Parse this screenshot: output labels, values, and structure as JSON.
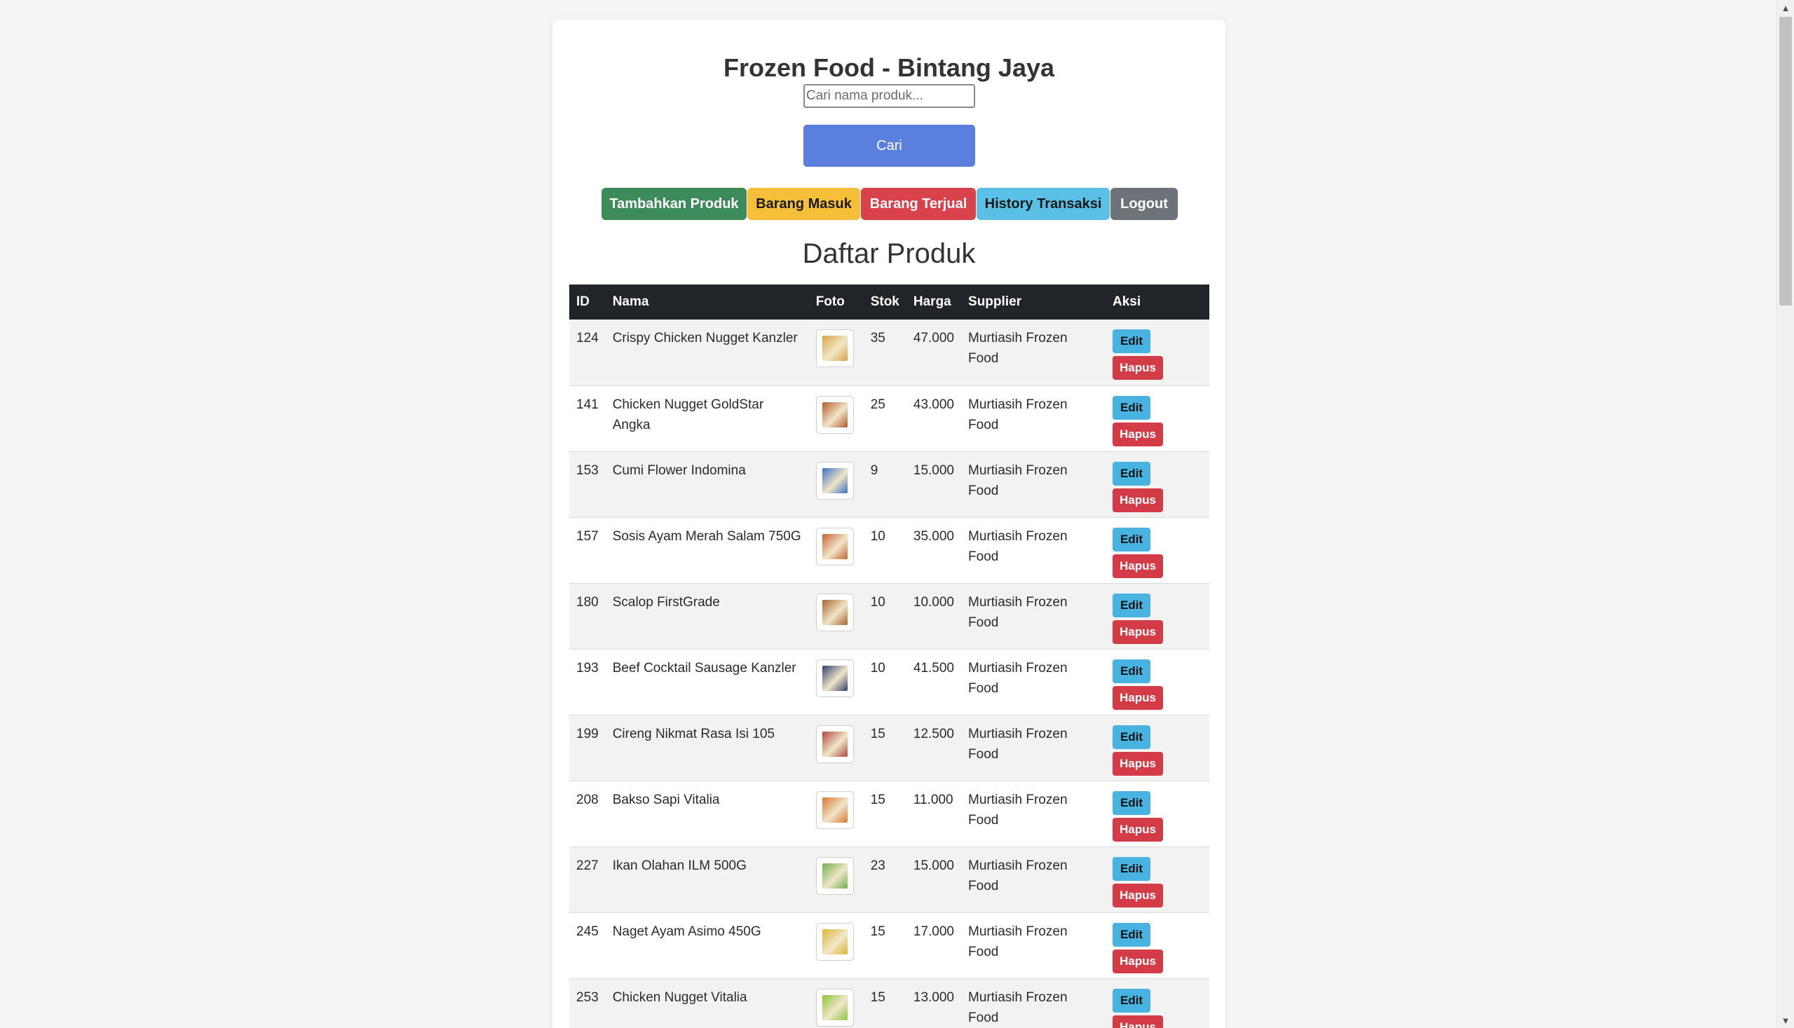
{
  "app": {
    "title": "Frozen Food - Bintang Jaya"
  },
  "search": {
    "placeholder": "Cari nama produk...",
    "value": "",
    "button_label": "Cari"
  },
  "nav": {
    "add_product": "Tambahkan Produk",
    "goods_in": "Barang Masuk",
    "goods_sold": "Barang Terjual",
    "history": "History Transaksi",
    "logout": "Logout"
  },
  "section": {
    "title": "Daftar Produk"
  },
  "table": {
    "headers": {
      "id": "ID",
      "nama": "Nama",
      "foto": "Foto",
      "stok": "Stok",
      "harga": "Harga",
      "supplier": "Supplier",
      "aksi": "Aksi"
    },
    "edit_label": "Edit",
    "delete_label": "Hapus",
    "rows": [
      {
        "id": "124",
        "nama": "Crispy Chicken Nugget Kanzler",
        "stok": "35",
        "harga": "47.000",
        "supplier": "Murtiasih Frozen Food",
        "photo_color": "#d9a441"
      },
      {
        "id": "141",
        "nama": "Chicken Nugget GoldStar Angka",
        "stok": "25",
        "harga": "43.000",
        "supplier": "Murtiasih Frozen Food",
        "photo_color": "#b55a2a"
      },
      {
        "id": "153",
        "nama": "Cumi Flower Indomina",
        "stok": "9",
        "harga": "15.000",
        "supplier": "Murtiasih Frozen Food",
        "photo_color": "#3a6fc4"
      },
      {
        "id": "157",
        "nama": "Sosis Ayam Merah Salam 750G",
        "stok": "10",
        "harga": "35.000",
        "supplier": "Murtiasih Frozen Food",
        "photo_color": "#c8622e"
      },
      {
        "id": "180",
        "nama": "Scalop FirstGrade",
        "stok": "10",
        "harga": "10.000",
        "supplier": "Murtiasih Frozen Food",
        "photo_color": "#a8642f"
      },
      {
        "id": "193",
        "nama": "Beef Cocktail Sausage Kanzler",
        "stok": "10",
        "harga": "41.500",
        "supplier": "Murtiasih Frozen Food",
        "photo_color": "#2f3f6e"
      },
      {
        "id": "199",
        "nama": "Cireng Nikmat Rasa Isi 105",
        "stok": "15",
        "harga": "12.500",
        "supplier": "Murtiasih Frozen Food",
        "photo_color": "#b0473c"
      },
      {
        "id": "208",
        "nama": "Bakso Sapi Vitalia",
        "stok": "15",
        "harga": "11.000",
        "supplier": "Murtiasih Frozen Food",
        "photo_color": "#d9762e"
      },
      {
        "id": "227",
        "nama": "Ikan Olahan ILM 500G",
        "stok": "23",
        "harga": "15.000",
        "supplier": "Murtiasih Frozen Food",
        "photo_color": "#6fb04d"
      },
      {
        "id": "245",
        "nama": "Naget Ayam Asimo 450G",
        "stok": "15",
        "harga": "17.000",
        "supplier": "Murtiasih Frozen Food",
        "photo_color": "#e0b432"
      },
      {
        "id": "253",
        "nama": "Chicken Nugget Vitalia",
        "stok": "15",
        "harga": "13.000",
        "supplier": "Murtiasih Frozen Food",
        "photo_color": "#8cc43c"
      }
    ]
  }
}
